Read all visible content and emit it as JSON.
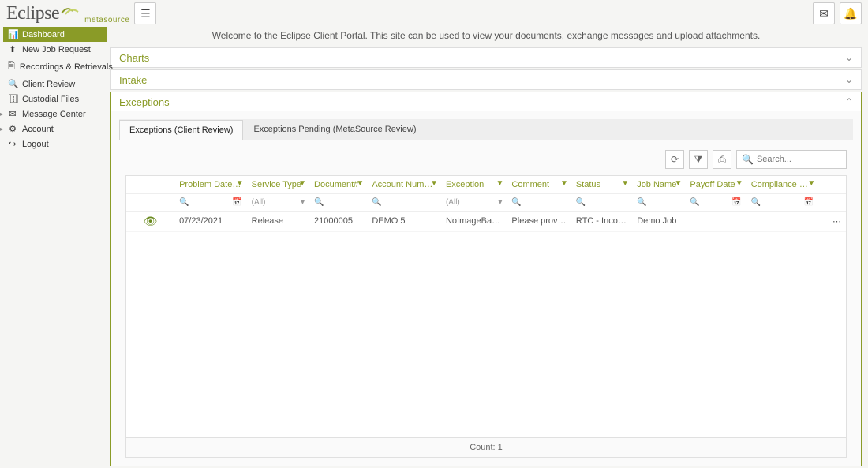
{
  "brand": {
    "main": "Eclipse",
    "sub": "metasource"
  },
  "welcome": "Welcome to the Eclipse Client Portal. This site can be used to view your documents, exchange messages and upload attachments.",
  "sidebar": {
    "items": [
      {
        "icon": "chart-bar",
        "label": "Dashboard",
        "active": true,
        "expandable": false
      },
      {
        "icon": "upload",
        "label": "New Job Request",
        "expandable": false
      },
      {
        "icon": "file",
        "label": "Recordings & Retrievals",
        "expandable": false
      },
      {
        "icon": "search",
        "label": "Client Review",
        "expandable": false
      },
      {
        "icon": "briefcase",
        "label": "Custodial Files",
        "expandable": false
      },
      {
        "icon": "mail",
        "label": "Message Center",
        "expandable": true
      },
      {
        "icon": "gear",
        "label": "Account",
        "expandable": true
      },
      {
        "icon": "logout",
        "label": "Logout",
        "expandable": false
      }
    ]
  },
  "panels": {
    "charts": {
      "title": "Charts",
      "open": false
    },
    "intake": {
      "title": "Intake",
      "open": false
    },
    "exceptions": {
      "title": "Exceptions",
      "open": true
    }
  },
  "tabs": [
    {
      "label": "Exceptions (Client Review)",
      "active": true
    },
    {
      "label": "Exceptions Pending (MetaSource Review)",
      "active": false
    }
  ],
  "search": {
    "placeholder": "Search..."
  },
  "grid": {
    "columns": [
      "",
      "Problem Date",
      "Service Type",
      "Document#",
      "Account Number",
      "Exception",
      "Comment",
      "Status",
      "Job Name",
      "Payoff Date",
      "Compliance Date",
      ""
    ],
    "filter_all": "(All)",
    "rows": [
      {
        "problem_date": "07/23/2021",
        "service_type": "Release",
        "document_no": "21000005",
        "account_no": "DEMO 5",
        "exception": "NoImageBadImage",
        "comment": "Please provide the ...",
        "status": "RTC - Incomplete",
        "job_name": "Demo Job",
        "payoff_date": "",
        "compliance_date": ""
      }
    ],
    "footer": "Count: 1"
  },
  "icons": {
    "menu": "☰",
    "mail": "✉",
    "bell": "🔔",
    "refresh": "⟳",
    "filter_clear": "⧩",
    "export": "⎙",
    "search": "🔍",
    "funnel": "▼",
    "sort_asc": "↑1",
    "calendar": "📅",
    "dropdown": "▾",
    "eye": "👁",
    "dots": "⋯",
    "chevron_down": "⌄",
    "chevron_up": "⌃",
    "nav_chart": "📊",
    "nav_upload": "⬆",
    "nav_file": "🗎",
    "nav_search": "🔍",
    "nav_briefcase": "🗄",
    "nav_mail": "✉",
    "nav_gear": "⚙",
    "nav_logout": "↪"
  }
}
